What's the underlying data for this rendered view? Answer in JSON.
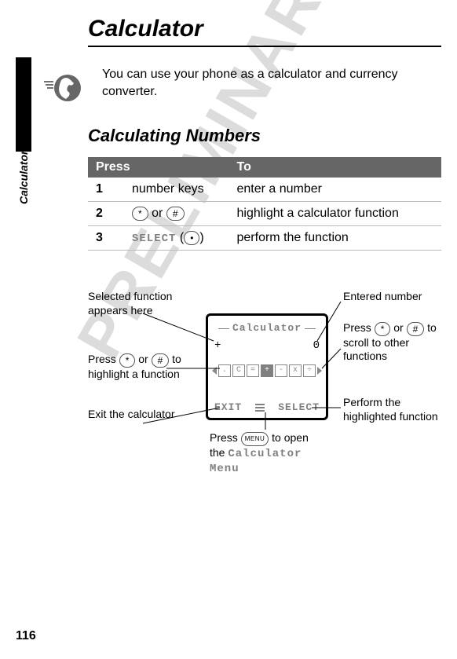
{
  "page_number": "116",
  "side_label": "Calculator",
  "watermark": "PRELIMINARY",
  "heading1": "Calculator",
  "intro": "You can use your phone as a calculator and currency converter.",
  "heading2": "Calculating Numbers",
  "table": {
    "headers": {
      "press": "Press",
      "to": "To"
    },
    "rows": [
      {
        "num": "1",
        "press_plain": "number keys",
        "to": "enter a number"
      },
      {
        "num": "2",
        "press_key1": "*",
        "press_or": "or",
        "press_key2": "#",
        "to": "highlight a calculator function"
      },
      {
        "num": "3",
        "press_select": "SELECT",
        "press_paren_open": "(",
        "press_paren_key": "•",
        "press_paren_close": ")",
        "to": "perform the function"
      }
    ]
  },
  "screen": {
    "title": "Calculator",
    "func_indicator": "+",
    "entered_value": "0",
    "functions": [
      ".",
      "C",
      "=",
      "+",
      "-",
      "x",
      "÷"
    ],
    "highlighted_index": 3,
    "soft_left": "EXIT",
    "soft_right": "SELECT"
  },
  "annotations": {
    "selected": "Selected function appears here",
    "highlight_pre": "Press ",
    "highlight_key1": "*",
    "highlight_or": " or ",
    "highlight_key2": "#",
    "highlight_post": " to highlight a function",
    "exit": "Exit the calculator",
    "entered": "Entered number",
    "scroll_pre": "Press ",
    "scroll_key1": "*",
    "scroll_or": " or ",
    "scroll_key2": "#",
    "scroll_post": " to scroll to other functions",
    "perform": "Perform the highlighted function",
    "openmenu_pre": "Press ",
    "openmenu_key": "MENU",
    "openmenu_mid": " to open the ",
    "openmenu_grey": "Calculator Menu"
  }
}
